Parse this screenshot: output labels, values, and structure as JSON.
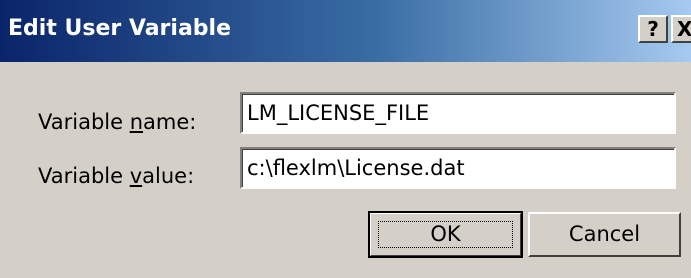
{
  "dialog": {
    "title": "Edit User Variable",
    "help_button": "?",
    "close_button": "X"
  },
  "variable_name": {
    "label_pre": "Variable ",
    "label_accel": "n",
    "label_post": "ame:",
    "value": "LM_LICENSE_FILE"
  },
  "variable_value": {
    "label_pre": "Variable ",
    "label_accel": "v",
    "label_post": "alue:",
    "value": "c:\\flexlm\\License.dat"
  },
  "buttons": {
    "ok": "OK",
    "cancel": "Cancel"
  },
  "colors": {
    "titlebar_start": "#0a246a",
    "titlebar_end": "#a6caf0",
    "dialog_bg": "#d4d0c8"
  }
}
